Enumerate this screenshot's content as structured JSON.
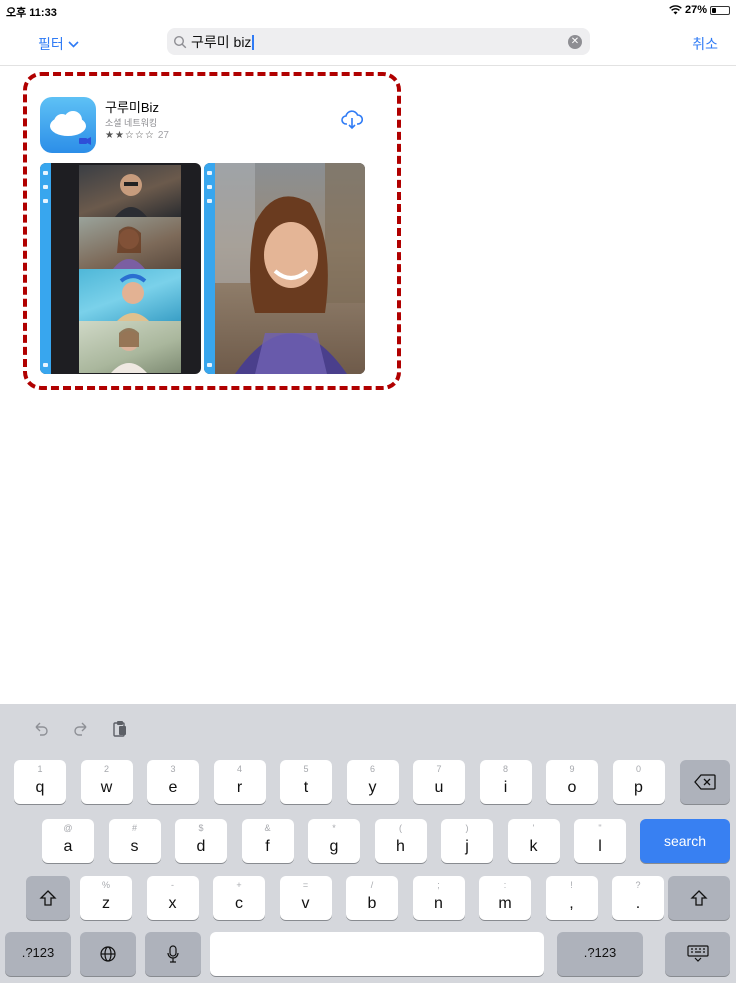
{
  "status_bar": {
    "time": "오후 11:33",
    "battery": "27%",
    "battery_fraction": 0.27
  },
  "search": {
    "filter_label": "필터",
    "query": "구루미 biz",
    "cancel_label": "취소"
  },
  "app": {
    "name": "구루미Biz",
    "category": "소셜 네트워킹",
    "stars_text": "★★☆☆☆",
    "rating_value": 2,
    "rating_count": "27",
    "border_color": "#b00000",
    "accent_color": "#2f7bf5"
  },
  "keyboard": {
    "row1": [
      {
        "alt": "1",
        "key": "q"
      },
      {
        "alt": "2",
        "key": "w"
      },
      {
        "alt": "3",
        "key": "e"
      },
      {
        "alt": "4",
        "key": "r"
      },
      {
        "alt": "5",
        "key": "t"
      },
      {
        "alt": "6",
        "key": "y"
      },
      {
        "alt": "7",
        "key": "u"
      },
      {
        "alt": "8",
        "key": "i"
      },
      {
        "alt": "9",
        "key": "o"
      },
      {
        "alt": "0",
        "key": "p"
      }
    ],
    "row2": [
      {
        "alt": "@",
        "key": "a"
      },
      {
        "alt": "#",
        "key": "s"
      },
      {
        "alt": "$",
        "key": "d"
      },
      {
        "alt": "&",
        "key": "f"
      },
      {
        "alt": "*",
        "key": "g"
      },
      {
        "alt": "(",
        "key": "h"
      },
      {
        "alt": ")",
        "key": "j"
      },
      {
        "alt": "'",
        "key": "k"
      },
      {
        "alt": "\"",
        "key": "l"
      }
    ],
    "row3": [
      {
        "alt": "%",
        "key": "z"
      },
      {
        "alt": "-",
        "key": "x"
      },
      {
        "alt": "+",
        "key": "c"
      },
      {
        "alt": "=",
        "key": "v"
      },
      {
        "alt": "/",
        "key": "b"
      },
      {
        "alt": ";",
        "key": "n"
      },
      {
        "alt": ":",
        "key": "m"
      },
      {
        "alt": "!",
        "key": ","
      },
      {
        "alt": "?",
        "key": "."
      }
    ],
    "search_label": "search",
    "numbers_label": ".?123"
  }
}
